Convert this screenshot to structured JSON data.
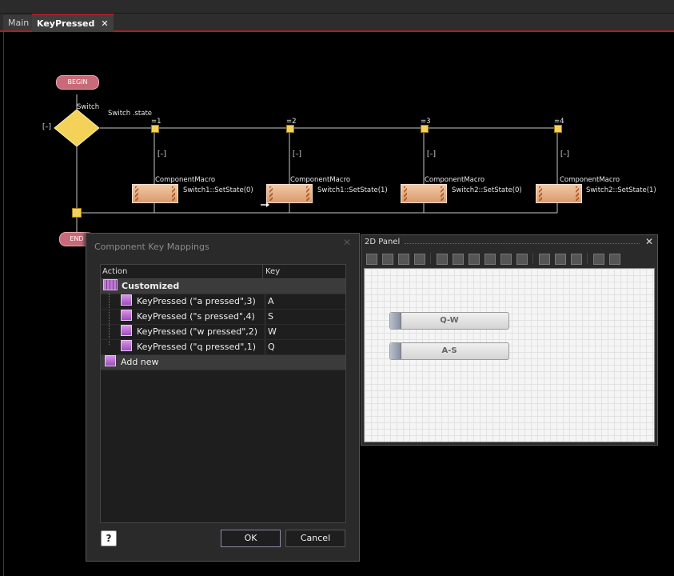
{
  "tabs": [
    {
      "label": "Main"
    },
    {
      "label": "KeyPressed",
      "close": "✕"
    }
  ],
  "flowchart": {
    "begin": "BEGIN",
    "end": "END",
    "switch_label": "Switch",
    "switch_state": "Switch .state",
    "collapse": "[–]",
    "cases": [
      {
        "label": "=1",
        "collapse": "[–]",
        "macro_title": "ComponentMacro",
        "macro_call": "Switch1::SetState(0)"
      },
      {
        "label": "=2",
        "collapse": "[–]",
        "macro_title": "ComponentMacro",
        "macro_call": "Switch1::SetState(1)"
      },
      {
        "label": "=3",
        "collapse": "[–]",
        "macro_title": "ComponentMacro",
        "macro_call": "Switch2::SetState(0)"
      },
      {
        "label": "=4",
        "collapse": "[–]",
        "macro_title": "ComponentMacro",
        "macro_call": "Switch2::SetState(1)"
      }
    ],
    "colors": {
      "wire": "#c8c8c8",
      "decision": "#f4d25a",
      "terminator": "#c96a78"
    }
  },
  "dialog": {
    "title": "Component Key Mappings",
    "close": "✕",
    "columns": {
      "action": "Action",
      "key": "Key"
    },
    "group": "Customized",
    "rows": [
      {
        "action": "KeyPressed (\"a pressed\",3)",
        "key": "A"
      },
      {
        "action": "KeyPressed (\"s pressed\",4)",
        "key": "S"
      },
      {
        "action": "KeyPressed (\"w pressed\",2)",
        "key": "W"
      },
      {
        "action": "KeyPressed (\"q pressed\",1)",
        "key": "Q"
      }
    ],
    "add_new": "Add new",
    "help": "?",
    "ok": "OK",
    "cancel": "Cancel"
  },
  "panel": {
    "title": "2D Panel",
    "close": "✕",
    "switches": [
      {
        "label": "Q-W"
      },
      {
        "label": "A-S"
      }
    ]
  }
}
